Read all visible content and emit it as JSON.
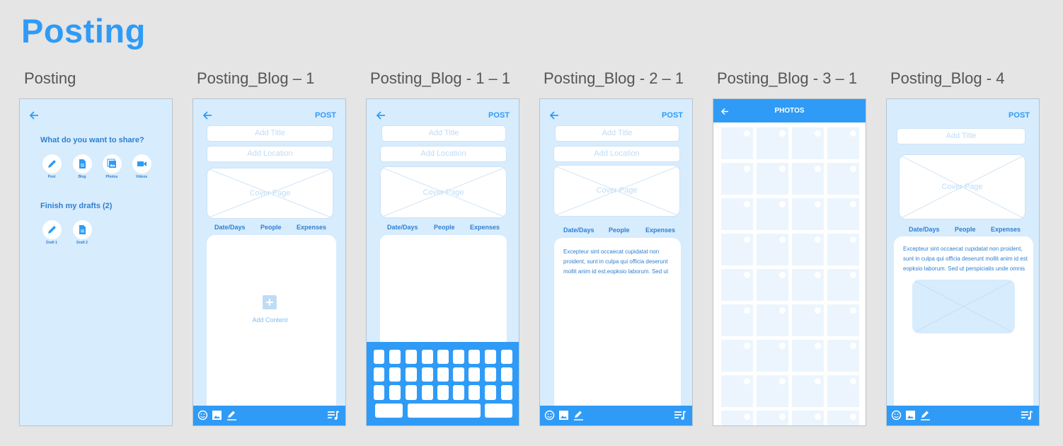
{
  "page_title": "Posting",
  "screens": [
    {
      "label": "Posting"
    },
    {
      "label": "Posting_Blog – 1"
    },
    {
      "label": "Posting_Blog - 1 – 1"
    },
    {
      "label": "Posting_Blog - 2 – 1"
    },
    {
      "label": "Posting_Blog - 3 – 1"
    },
    {
      "label": "Posting_Blog - 4"
    }
  ],
  "posting": {
    "share_heading": "What do you want to share?",
    "share_options": [
      {
        "label": "Post",
        "icon": "pencil-icon"
      },
      {
        "label": "Blog",
        "icon": "document-icon"
      },
      {
        "label": "Photos",
        "icon": "photos-icon"
      },
      {
        "label": "Videos",
        "icon": "video-icon"
      }
    ],
    "drafts_heading": "Finish my drafts (2)",
    "drafts": [
      {
        "label": "Draft 1",
        "icon": "pencil-icon"
      },
      {
        "label": "Draft 2",
        "icon": "document-icon"
      }
    ]
  },
  "blog": {
    "post_label": "POST",
    "title_placeholder": "Add Title",
    "location_placeholder": "Add Location",
    "cover_label": "Cover Page",
    "tabs": [
      "Date/Days",
      "People",
      "Expenses"
    ],
    "add_content_label": "Add Content",
    "paragraph_2": "Excepteur sint occaecat cupidatat non proident, sunt in culpa qui officia deserunt mollit anim id est.eopksio laborum. Sed ut",
    "paragraph_4": "Excepteur sint occaecat cupidatat non proident, sunt in culpa qui officia deserunt mollit anim id est eopksio laborum. Sed ut perspiciatis unde omnis"
  },
  "photos": {
    "title": "PHOTOS"
  },
  "colors": {
    "accent": "#2f9bf6",
    "screen_bg": "#d7ecfd",
    "canvas_bg": "#e5e5e5",
    "text_blue": "#2f7fd0"
  }
}
